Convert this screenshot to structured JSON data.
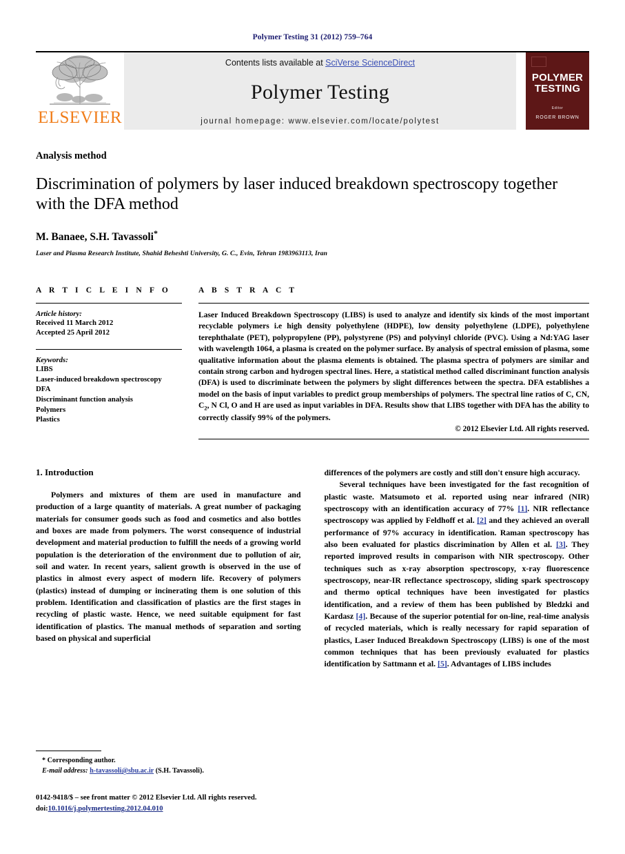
{
  "running_head": "Polymer Testing 31 (2012) 759–764",
  "masthead": {
    "publisher_name": "ELSEVIER",
    "contents_prefix": "Contents lists available at ",
    "contents_link": "SciVerse ScienceDirect",
    "journal_name": "Polymer Testing",
    "homepage": "journal homepage: www.elsevier.com/locate/polytest",
    "cover": {
      "title_line1": "POLYMER",
      "title_line2": "TESTING",
      "editor_label": "Editor",
      "editor_name": "ROGER BROWN"
    }
  },
  "article": {
    "kicker": "Analysis method",
    "title": "Discrimination of polymers by laser induced breakdown spectroscopy together with the DFA method",
    "authors": "M. Banaee, S.H. Tavassoli",
    "corresponding_marker": "*",
    "affiliation": "Laser and Plasma Research Institute, Shahid Beheshti University, G. C., Evin, Tehran 1983963113, Iran"
  },
  "article_info": {
    "heading": "A R T I C L E   I N F O",
    "history_label": "Article history:",
    "history_lines": [
      "Received 11 March 2012",
      "Accepted 25 April 2012"
    ],
    "keywords_label": "Keywords:",
    "keywords": [
      "LIBS",
      "Laser-induced breakdown spectroscopy",
      "DFA",
      "Discriminant function analysis",
      "Polymers",
      "Plastics"
    ]
  },
  "abstract": {
    "heading": "A B S T R A C T",
    "text_part1": "Laser Induced Breakdown Spectroscopy (LIBS) is used to analyze and identify six kinds of the most important recyclable polymers i.e high density polyethylene (HDPE), low density polyethylene (LDPE), polyethylene terephthalate (PET), polypropylene (PP), polystyrene (PS) and polyvinyl chloride (PVC). Using a Nd:YAG laser with wavelength 1064, a plasma is created on the polymer surface. By analysis of spectral emission of plasma, some qualitative information about the plasma elements is obtained. The plasma spectra of polymers are similar and contain strong carbon and hydrogen spectral lines. Here, a statistical method called discriminant function analysis (DFA) is used to discriminate between the polymers by slight differences between the spectra. DFA establishes a model on the basis of input variables to predict group memberships of polymers. The spectral line ratios of C, CN, C",
    "subscript": "2",
    "text_part2": ", N Cl, O and H are used as input variables in DFA. Results show that LIBS together with DFA has the ability to correctly classify 99% of the polymers.",
    "copyright": "© 2012 Elsevier Ltd. All rights reserved."
  },
  "introduction": {
    "heading": "1. Introduction",
    "left_paragraph": "Polymers and mixtures of them are used in manufacture and production of a large quantity of materials. A great number of packaging materials for consumer goods such as food and cosmetics and also bottles and boxes are made from polymers. The worst consequence of industrial development and material production to fulfill the needs of a growing world population is the deterioration of the environment due to pollution of air, soil and water. In recent years, salient growth is observed in the use of plastics in almost every aspect of modern life. Recovery of polymers (plastics) instead of dumping or incinerating them is one solution of this problem. Identification and classification of plastics are the first stages in recycling of plastic waste. Hence, we need suitable equipment for fast identification of plastics. The manual methods of separation and sorting based on physical and superficial",
    "right_continuation": "differences of the polymers are costly and still don't ensure high accuracy.",
    "right_paragraph_segments": [
      {
        "text": "Several techniques have been investigated for the fast recognition of plastic waste. Matsumoto et al. reported using near infrared (NIR) spectroscopy with an identification accuracy of 77% ",
        "type": "text"
      },
      {
        "text": "[1]",
        "type": "ref"
      },
      {
        "text": ". NIR reflectance spectroscopy was applied by Feldhoff et al. ",
        "type": "text"
      },
      {
        "text": "[2]",
        "type": "ref"
      },
      {
        "text": " and they achieved an overall performance of 97% accuracy in identification. Raman spectroscopy has also been evaluated for plastics discrimination by Allen et al. ",
        "type": "text"
      },
      {
        "text": "[3]",
        "type": "ref"
      },
      {
        "text": ". They reported improved results in comparison with NIR spectroscopy. Other techniques such as x-ray absorption spectroscopy, x-ray fluorescence spectroscopy, near-IR reflectance spectroscopy, sliding spark spectroscopy and thermo optical techniques have been investigated for plastics identification, and a review of them has been published by Bledzki and Kardasz ",
        "type": "text"
      },
      {
        "text": "[4]",
        "type": "ref"
      },
      {
        "text": ". Because of the superior potential for on-line, real-time analysis of recycled materials, which is really necessary for rapid separation of plastics, Laser Induced Breakdown Spectroscopy (LIBS) is one of the most common techniques that has been previously evaluated for plastics identification by Sattmann et al. ",
        "type": "text"
      },
      {
        "text": "[5]",
        "type": "ref"
      },
      {
        "text": ". Advantages of LIBS includes",
        "type": "text"
      }
    ]
  },
  "footnote": {
    "corresponding": "* Corresponding author.",
    "email_label": "E-mail address:",
    "email": "h-tavassoli@sbu.ac.ir",
    "email_suffix": "(S.H. Tavassoli)."
  },
  "bottom_matter": {
    "issn_line": "0142-9418/$ – see front matter © 2012 Elsevier Ltd. All rights reserved.",
    "doi_label": "doi:",
    "doi": "10.1016/j.polymertesting.2012.04.010"
  },
  "colors": {
    "running_head": "#1b1b6f",
    "link_blue": "#2b3fa0",
    "elsevier_orange": "#f07d1a",
    "cover_maroon": "#5d1717",
    "banner_gray": "#ebebeb"
  }
}
